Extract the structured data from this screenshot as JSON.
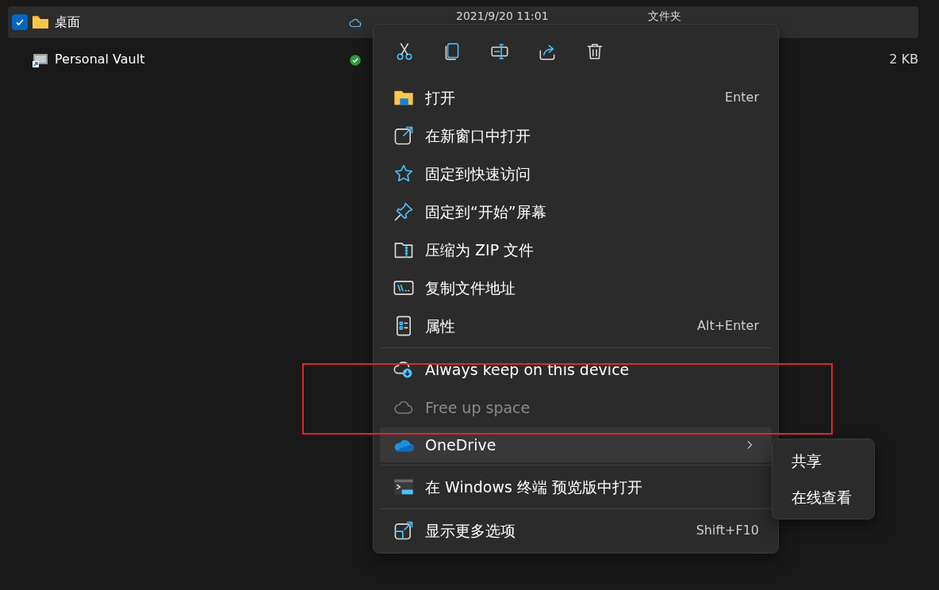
{
  "files": [
    {
      "name": "桌面",
      "kind": "folder",
      "checked": true,
      "selected": true,
      "synced": false,
      "date": "2021/9/20 11:01",
      "type": "文件夹"
    },
    {
      "name": "Personal Vault",
      "kind": "vault",
      "checked": false,
      "selected": false,
      "synced": true,
      "size": "2 KB"
    }
  ],
  "context_menu": {
    "groups": [
      {
        "items": [
          {
            "label": "打开",
            "shortcut": "Enter",
            "disabled": false
          },
          {
            "label": "在新窗口中打开",
            "disabled": false
          },
          {
            "label": "固定到快速访问",
            "disabled": false
          },
          {
            "label": "固定到“开始”屏幕",
            "disabled": false
          },
          {
            "label": "压缩为 ZIP 文件",
            "disabled": false
          },
          {
            "label": "复制文件地址",
            "disabled": false
          },
          {
            "label": "属性",
            "shortcut": "Alt+Enter",
            "disabled": false
          }
        ]
      },
      {
        "items": [
          {
            "label": "Always keep on this device",
            "disabled": false
          },
          {
            "label": "Free up space",
            "disabled": true
          },
          {
            "label": "OneDrive",
            "disabled": false,
            "expanded": true
          }
        ]
      },
      {
        "items": [
          {
            "label": "在 Windows 终端 预览版中打开",
            "disabled": false
          }
        ]
      },
      {
        "items": [
          {
            "label": "显示更多选项",
            "shortcut": "Shift+F10",
            "disabled": false
          }
        ]
      }
    ]
  },
  "submenu": {
    "items": [
      {
        "label": "共享"
      },
      {
        "label": "在线查看"
      }
    ]
  }
}
